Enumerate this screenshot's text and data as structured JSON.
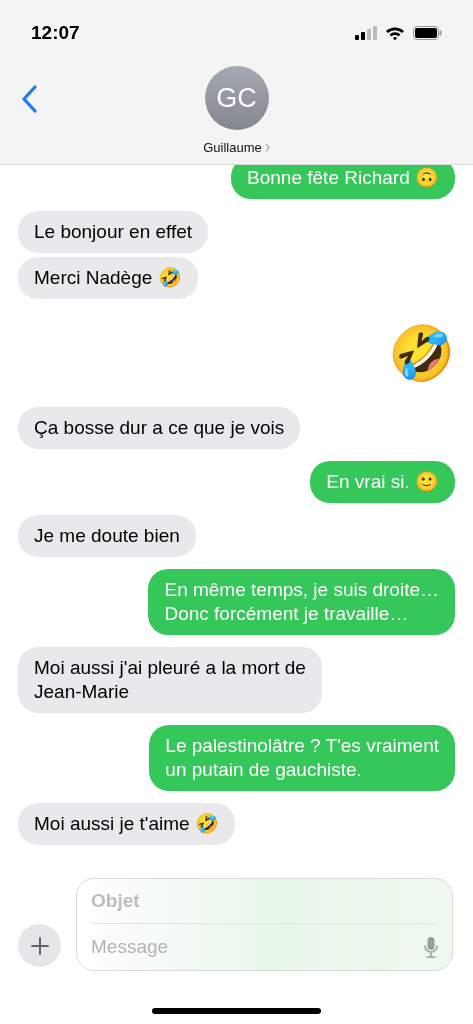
{
  "status_bar": {
    "time": "12:07"
  },
  "contact": {
    "initials": "GC",
    "name": "Guillaume"
  },
  "messages": [
    {
      "kind": "sent",
      "text": "Bonne fête Richard 🙃"
    },
    {
      "kind": "received",
      "text": "Le bonjour en effet"
    },
    {
      "kind": "received",
      "text": "Merci Nadège 🤣"
    },
    {
      "kind": "sent_emoji",
      "text": "🤣"
    },
    {
      "kind": "received",
      "text": "Ça bosse dur a ce que je vois"
    },
    {
      "kind": "sent",
      "text": "En vrai si. 🙂"
    },
    {
      "kind": "received",
      "text": "Je me doute bien"
    },
    {
      "kind": "sent",
      "text": "En même temps, je suis droite…\nDonc forcément je travaille…"
    },
    {
      "kind": "received",
      "text": "Moi aussi j'ai pleuré a la mort de\nJean-Marie"
    },
    {
      "kind": "sent",
      "text": "Le palestinolâtre ? T'es vraiment\nun putain de gauchiste."
    },
    {
      "kind": "received",
      "text": "Moi aussi je t'aime 🤣"
    }
  ],
  "composer": {
    "subject_placeholder": "Objet",
    "message_placeholder": "Message"
  }
}
